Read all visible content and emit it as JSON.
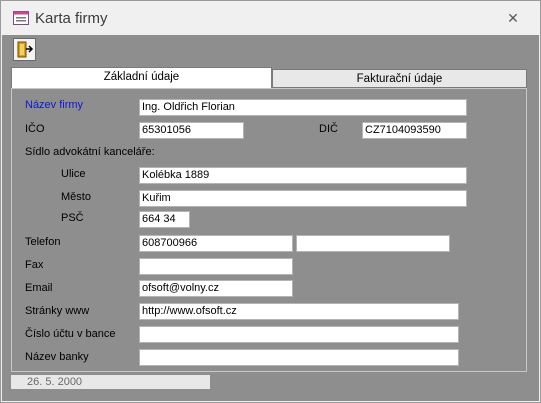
{
  "window": {
    "title": "Karta firmy",
    "close_glyph": "✕"
  },
  "toolbar": {
    "exit_icon": "door-exit-icon"
  },
  "tabs": [
    {
      "label": "Základní údaje",
      "active": true
    },
    {
      "label": "Fakturační údaje",
      "active": false
    }
  ],
  "fields": {
    "nazev_firmy": {
      "label": "Název firmy",
      "value": "Ing. Oldřich Florian"
    },
    "ico": {
      "label": "IČO",
      "value": "65301056"
    },
    "dic": {
      "label": "DIČ",
      "value": "CZ7104093590"
    },
    "sidlo_heading": "Sídlo advokátní kanceláře:",
    "ulice": {
      "label": "Ulice",
      "value": "Kolébka 1889"
    },
    "mesto": {
      "label": "Město",
      "value": "Kuřim"
    },
    "psc": {
      "label": "PSČ",
      "value": "664 34"
    },
    "telefon": {
      "label": "Telefon",
      "value": "608700966",
      "value2": ""
    },
    "fax": {
      "label": "Fax",
      "value": ""
    },
    "email": {
      "label": "Email",
      "value": "ofsoft@volny.cz"
    },
    "stranky": {
      "label": "Stránky www",
      "value": "http://www.ofsoft.cz"
    },
    "cislo_uctu": {
      "label": "Číslo účtu v bance",
      "value": ""
    },
    "nazev_banky": {
      "label": "Název banky",
      "value": ""
    }
  },
  "status": {
    "date": "26. 5. 2000"
  },
  "colors": {
    "form_bg": "#8e8e8e",
    "label_highlight": "#0a18d8"
  }
}
